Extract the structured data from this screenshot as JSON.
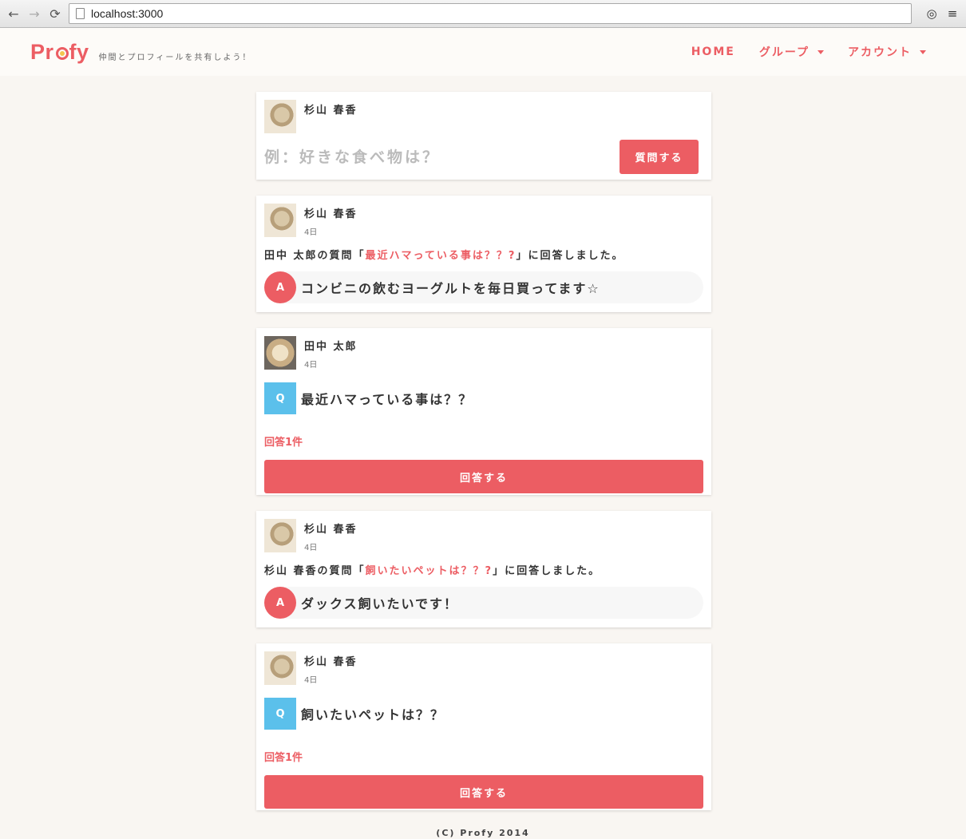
{
  "browser": {
    "url": "localhost:3000",
    "back_glyph": "←",
    "forward_glyph": "→",
    "reload_glyph": "⟳",
    "extension_glyph": "◎",
    "menu_glyph": "≡"
  },
  "header": {
    "logo_pre": "Pr",
    "logo_post": "fy",
    "tagline": "仲間とプロフィールを共有しよう！",
    "nav": [
      {
        "label": "HOME"
      },
      {
        "label": "グループ"
      },
      {
        "label": "アカウント"
      }
    ]
  },
  "ask": {
    "user_name": "杉山 春香",
    "placeholder": "例：好きな食べ物は？",
    "button_label": "質問する"
  },
  "feed": [
    {
      "type": "answer",
      "user_name": "杉山 春香",
      "time": "4日",
      "activity_pre": "田中 太郎の質問「",
      "question_link": "最近ハマっている事は？？?",
      "activity_post": "」に回答しました。",
      "badge": "A",
      "answer": "コンビニの飲むヨーグルトを毎日買ってます☆"
    },
    {
      "type": "question",
      "user_name": "田中 太郎",
      "time": "4日",
      "badge": "Q",
      "question": "最近ハマっている事は？？",
      "answer_count": "回答1件",
      "button_label": "回答する"
    },
    {
      "type": "answer",
      "user_name": "杉山 春香",
      "time": "4日",
      "activity_pre": "杉山 春香の質問「",
      "question_link": "飼いたいペットは？？?",
      "activity_post": "」に回答しました。",
      "badge": "A",
      "answer": "ダックス飼いたいです！"
    },
    {
      "type": "question",
      "user_name": "杉山 春香",
      "time": "4日",
      "badge": "Q",
      "question": "飼いたいペットは？？",
      "answer_count": "回答1件",
      "button_label": "回答する"
    }
  ],
  "footer": "(C) Profy 2014",
  "colors": {
    "accent": "#ec5d63",
    "question_badge": "#5bc0eb",
    "background": "#f9f6f2"
  }
}
